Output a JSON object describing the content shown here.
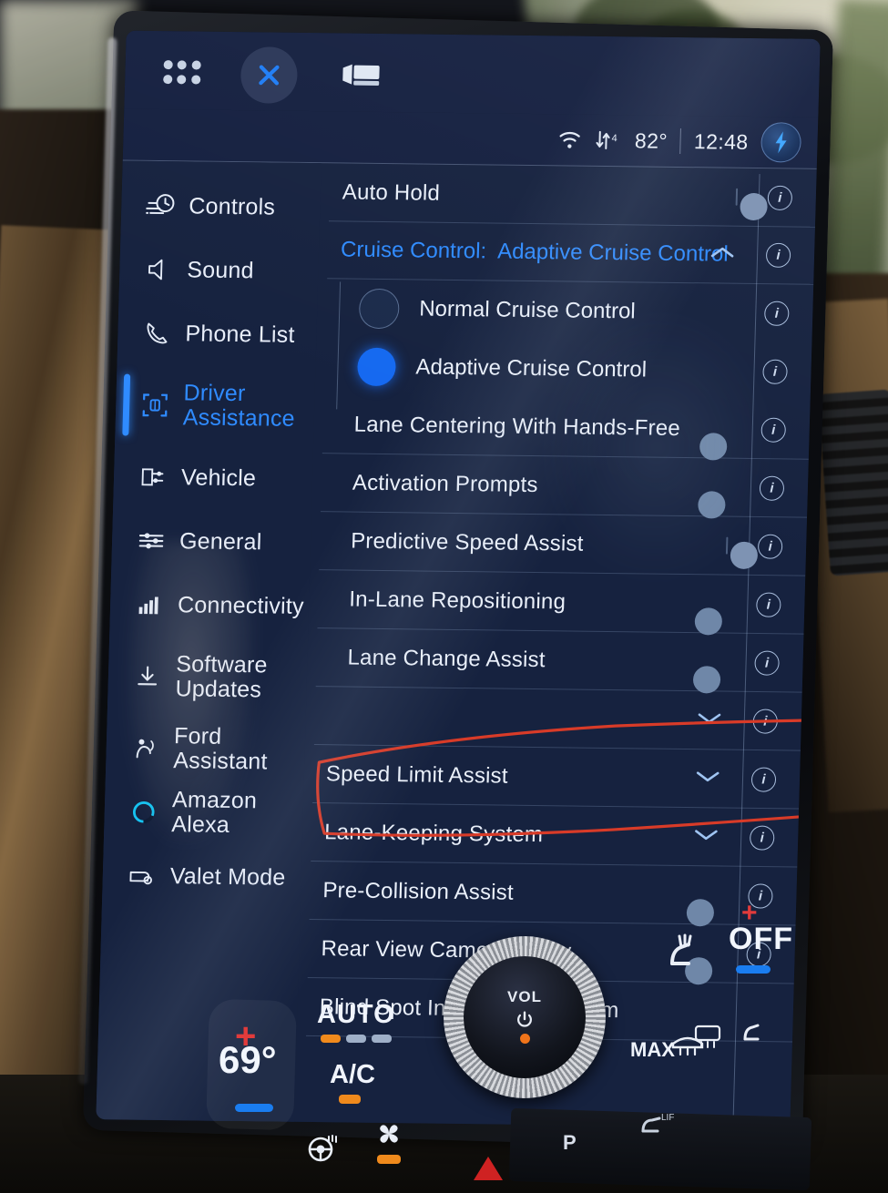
{
  "topbar": {
    "apps_icon": "apps-grid-icon",
    "close_icon": "close-x-icon",
    "camera_icon": "camera-icon"
  },
  "statusbar": {
    "wifi_icon": "wifi-icon",
    "data_icon": "data-transfer-icon",
    "data_badge": "4",
    "temperature": "82°",
    "time": "12:48",
    "profile_icon": "lightning-bolt-icon"
  },
  "sidebar": {
    "items": [
      {
        "label": "Controls",
        "icon": "controls-icon",
        "active": false
      },
      {
        "label": "Sound",
        "icon": "speaker-icon",
        "active": false
      },
      {
        "label": "Phone List",
        "icon": "phone-icon",
        "active": false
      },
      {
        "label": "Driver Assistance",
        "icon": "driver-assistance-icon",
        "active": true
      },
      {
        "label": "Vehicle",
        "icon": "vehicle-icon",
        "active": false
      },
      {
        "label": "General",
        "icon": "sliders-icon",
        "active": false
      },
      {
        "label": "Connectivity",
        "icon": "signal-bars-icon",
        "active": false
      },
      {
        "label": "Software Updates",
        "icon": "download-icon",
        "active": false
      },
      {
        "label": "Ford Assistant",
        "icon": "assistant-icon",
        "active": false
      },
      {
        "label": "Amazon Alexa",
        "icon": "alexa-icon",
        "active": false
      },
      {
        "label": "Valet Mode",
        "icon": "valet-icon",
        "active": false
      }
    ]
  },
  "settings": {
    "auto_hold": {
      "label": "Auto Hold",
      "control": "toggle",
      "state": "off"
    },
    "cruise_group": {
      "prefix": "Cruise Control:",
      "value": "Adaptive Cruise Control",
      "expander": "chevron-up-icon",
      "options": [
        {
          "label": "Normal Cruise Control",
          "selected": false
        },
        {
          "label": "Adaptive Cruise Control",
          "selected": true
        }
      ],
      "toggles": [
        {
          "label": "Lane Centering With Hands-Free",
          "state": "on"
        },
        {
          "label": "Activation Prompts",
          "state": "on"
        },
        {
          "label": "Predictive Speed Assist",
          "state": "off"
        },
        {
          "label": "In-Lane Repositioning",
          "state": "on",
          "highlighted": true
        },
        {
          "label": "Lane Change Assist",
          "state": "on",
          "highlighted": true
        }
      ],
      "collapse": "chevron-down-icon"
    },
    "rows": [
      {
        "label": "Speed Limit Assist",
        "control": "chevron-down-icon"
      },
      {
        "label": "Lane-Keeping System",
        "control": "chevron-down-icon"
      },
      {
        "label": "Pre-Collision Assist",
        "control": "toggle",
        "state": "on"
      },
      {
        "label": "Rear View Camera Delay",
        "control": "toggle",
        "state": "on"
      },
      {
        "label": "Blind Spot Information System",
        "control": "none"
      }
    ],
    "info_glyph": "i"
  },
  "climate": {
    "driver_temp": "69°",
    "driver_up": "+",
    "driver_down": "−",
    "auto_label": "AUTO",
    "ac_label": "A/C",
    "passenger_state": "OFF",
    "passenger_up": "+",
    "passenger_down": "−",
    "max_defrost": "MAX",
    "volume_label": "VOL",
    "power_icon": "power-icon",
    "fan_icon": "fan-icon",
    "heated_wheel_icon": "heated-steering-wheel-icon",
    "front_defrost_icon": "front-defrost-icon",
    "rear_defrost_icon": "rear-defrost-icon",
    "seat_icon": "heated-seat-icon",
    "park_label": "P"
  },
  "colors": {
    "screen_bg": "#16223f",
    "accent_blue": "#2f8bff",
    "toggle_on": "#0c6cf2",
    "annotation_red": "#d83b28",
    "text_primary": "#eaf0fa"
  }
}
